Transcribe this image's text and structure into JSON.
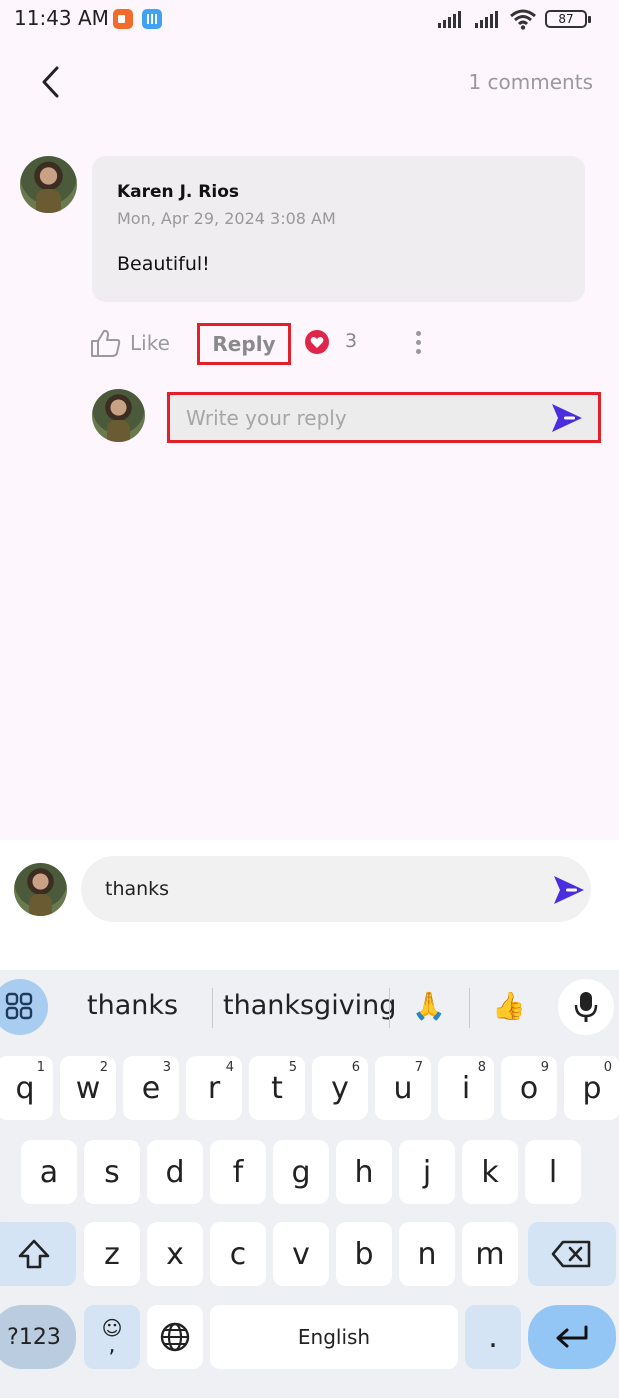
{
  "status_bar": {
    "time": "11:43 AM",
    "battery": "87"
  },
  "header": {
    "comments_count": "1 comments"
  },
  "comment": {
    "author": "Karen J. Rios",
    "date": "Mon, Apr 29, 2024 3:08 AM",
    "body": "Beautiful!",
    "like_label": "Like",
    "reply_label": "Reply",
    "heart_count": "3"
  },
  "reply": {
    "placeholder": "Write your reply"
  },
  "composer": {
    "text": "thanks"
  },
  "keyboard": {
    "suggestions": [
      "thanks",
      "thanksgiving",
      "🙏",
      "👍"
    ],
    "row1": [
      {
        "label": "q",
        "num": "1"
      },
      {
        "label": "w",
        "num": "2"
      },
      {
        "label": "e",
        "num": "3"
      },
      {
        "label": "r",
        "num": "4"
      },
      {
        "label": "t",
        "num": "5"
      },
      {
        "label": "y",
        "num": "6"
      },
      {
        "label": "u",
        "num": "7"
      },
      {
        "label": "i",
        "num": "8"
      },
      {
        "label": "o",
        "num": "9"
      },
      {
        "label": "p",
        "num": "0"
      }
    ],
    "row2": [
      "a",
      "s",
      "d",
      "f",
      "g",
      "h",
      "j",
      "k",
      "l"
    ],
    "row3": [
      "z",
      "x",
      "c",
      "v",
      "b",
      "n",
      "m"
    ],
    "symbols_label": "?123",
    "comma_label": ",",
    "space_label": "English",
    "period_label": "."
  },
  "colors": {
    "accent": "#4b2de0",
    "highlight": "#e2202a",
    "heart": "#e0244a"
  }
}
